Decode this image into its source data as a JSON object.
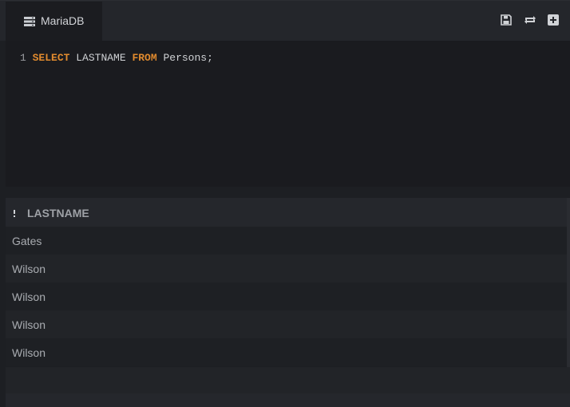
{
  "tab": {
    "label": "MariaDB",
    "icon": "database-icon"
  },
  "toolbar": {
    "save_icon": "save-icon",
    "refresh_icon": "refresh-icon",
    "add_icon": "add-icon"
  },
  "editor": {
    "line_number": "1",
    "kw_select": "SELECT",
    "col": " LASTNAME ",
    "kw_from": "FROM",
    "table": " Persons;"
  },
  "results": {
    "column": "LASTNAME",
    "rows": [
      "Gates",
      "Wilson",
      "Wilson",
      "Wilson",
      "Wilson"
    ]
  },
  "colors": {
    "keyword": "#e08a2e",
    "background": "#1d1f23"
  }
}
